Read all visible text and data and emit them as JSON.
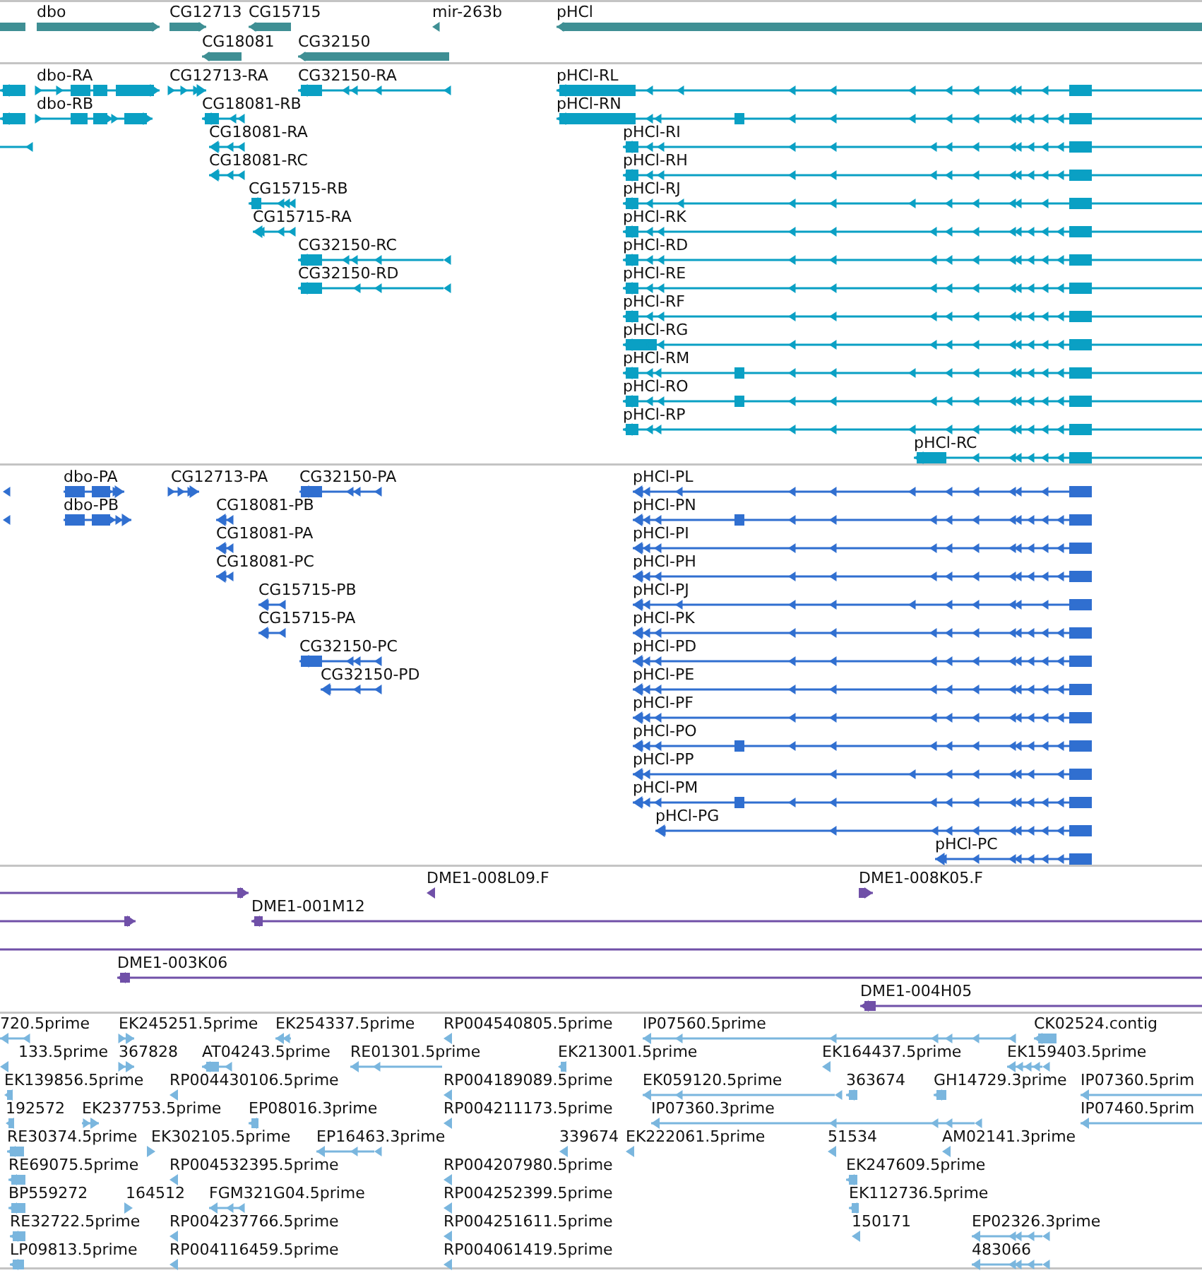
{
  "tracks": [
    {
      "kind": "genes",
      "features": [
        {
          "label": "dbo"
        },
        {
          "label": "CG12713"
        },
        {
          "label": "CG15715"
        },
        {
          "label": "mir-263b"
        },
        {
          "label": "pHCl"
        },
        {
          "label": "CG18081"
        },
        {
          "label": "CG32150"
        }
      ]
    },
    {
      "kind": "transcripts",
      "features": [
        {
          "label": "dbo-RA"
        },
        {
          "label": "CG12713-RA"
        },
        {
          "label": "CG32150-RA"
        },
        {
          "label": "pHCl-RL"
        },
        {
          "label": "dbo-RB"
        },
        {
          "label": "CG18081-RB"
        },
        {
          "label": "pHCl-RN"
        },
        {
          "label": "CG18081-RA"
        },
        {
          "label": "pHCl-RI"
        },
        {
          "label": "CG18081-RC"
        },
        {
          "label": "pHCl-RH"
        },
        {
          "label": "CG15715-RB"
        },
        {
          "label": "pHCl-RJ"
        },
        {
          "label": "CG15715-RA"
        },
        {
          "label": "pHCl-RK"
        },
        {
          "label": "CG32150-RC"
        },
        {
          "label": "pHCl-RD"
        },
        {
          "label": "CG32150-RD"
        },
        {
          "label": "pHCl-RE"
        },
        {
          "label": "pHCl-RF"
        },
        {
          "label": "pHCl-RG"
        },
        {
          "label": "pHCl-RM"
        },
        {
          "label": "pHCl-RO"
        },
        {
          "label": "pHCl-RP"
        },
        {
          "label": "pHCl-RC"
        }
      ]
    },
    {
      "kind": "proteins",
      "features": [
        {
          "label": "dbo-PA"
        },
        {
          "label": "CG12713-PA"
        },
        {
          "label": "CG32150-PA"
        },
        {
          "label": "pHCl-PL"
        },
        {
          "label": "dbo-PB"
        },
        {
          "label": "CG18081-PB"
        },
        {
          "label": "pHCl-PN"
        },
        {
          "label": "CG18081-PA"
        },
        {
          "label": "pHCl-PI"
        },
        {
          "label": "CG18081-PC"
        },
        {
          "label": "pHCl-PH"
        },
        {
          "label": "CG15715-PB"
        },
        {
          "label": "pHCl-PJ"
        },
        {
          "label": "CG15715-PA"
        },
        {
          "label": "pHCl-PK"
        },
        {
          "label": "CG32150-PC"
        },
        {
          "label": "pHCl-PD"
        },
        {
          "label": "CG32150-PD"
        },
        {
          "label": "pHCl-PE"
        },
        {
          "label": "pHCl-PF"
        },
        {
          "label": "pHCl-PO"
        },
        {
          "label": "pHCl-PP"
        },
        {
          "label": "pHCl-PM"
        },
        {
          "label": "pHCl-PG"
        },
        {
          "label": "pHCl-PC"
        }
      ]
    },
    {
      "kind": "clones",
      "features": [
        {
          "label": "DME1-008L09.F"
        },
        {
          "label": "DME1-008K05.F"
        },
        {
          "label": "DME1-001M12"
        },
        {
          "label": "DME1-003K06"
        },
        {
          "label": "DME1-004H05"
        }
      ]
    },
    {
      "kind": "ests",
      "features": [
        {
          "label": "720.5prime"
        },
        {
          "label": "EK245251.5prime"
        },
        {
          "label": "EK254337.5prime"
        },
        {
          "label": "RP004540805.5prime"
        },
        {
          "label": "IP07560.5prime"
        },
        {
          "label": "CK02524.contig"
        },
        {
          "label": "133.5prime"
        },
        {
          "label": "367828"
        },
        {
          "label": "AT04243.5prime"
        },
        {
          "label": "RE01301.5prime"
        },
        {
          "label": "EK213001.5prime"
        },
        {
          "label": "EK164437.5prime"
        },
        {
          "label": "EK159403.5prime"
        },
        {
          "label": "EK139856.5prime"
        },
        {
          "label": "RP004430106.5prime"
        },
        {
          "label": "RP004189089.5prime"
        },
        {
          "label": "EK059120.5prime"
        },
        {
          "label": "363674"
        },
        {
          "label": "GH14729.3prime"
        },
        {
          "label": "IP07360.5prim"
        },
        {
          "label": "192572"
        },
        {
          "label": "EK237753.5prime"
        },
        {
          "label": "EP08016.3prime"
        },
        {
          "label": "RP004211173.5prime"
        },
        {
          "label": "IP07360.3prime"
        },
        {
          "label": "IP07460.5prim"
        },
        {
          "label": "RE30374.5prime"
        },
        {
          "label": "EK302105.5prime"
        },
        {
          "label": "EP16463.3prime"
        },
        {
          "label": "339674"
        },
        {
          "label": "EK222061.5prime"
        },
        {
          "label": "51534"
        },
        {
          "label": "AM02141.3prime"
        },
        {
          "label": "RE69075.5prime"
        },
        {
          "label": "RP004532395.5prime"
        },
        {
          "label": "RP004207980.5prime"
        },
        {
          "label": "EK247609.5prime"
        },
        {
          "label": "BP559272"
        },
        {
          "label": "164512"
        },
        {
          "label": "FGM321G04.5prime"
        },
        {
          "label": "RP004252399.5prime"
        },
        {
          "label": "EK112736.5prime"
        },
        {
          "label": "RE32722.5prime"
        },
        {
          "label": "RP004237766.5prime"
        },
        {
          "label": "RP004251611.5prime"
        },
        {
          "label": "150171"
        },
        {
          "label": "EP02326.3prime"
        },
        {
          "label": "LP09813.5prime"
        },
        {
          "label": "RP004116459.5prime"
        },
        {
          "label": "RP004061419.5prime"
        },
        {
          "label": "483066"
        }
      ]
    }
  ]
}
